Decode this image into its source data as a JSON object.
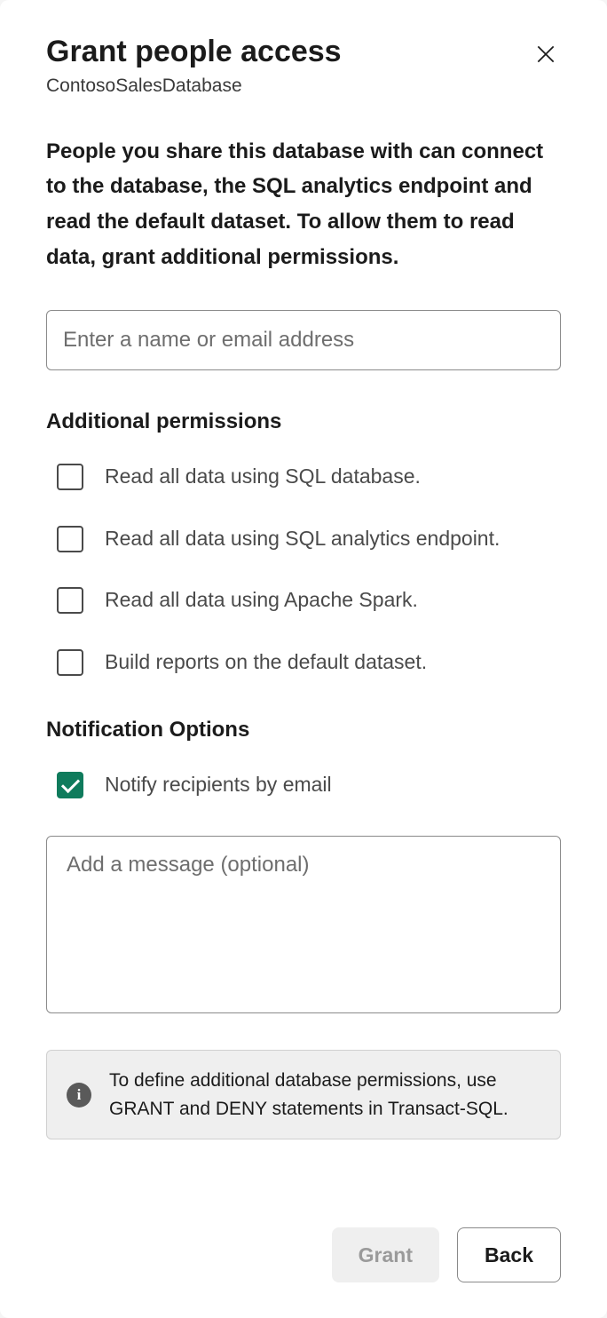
{
  "dialog": {
    "title": "Grant people access",
    "subtitle": "ContosoSalesDatabase",
    "description": "People you share this database with can connect to the database, the SQL analytics endpoint and read the default dataset. To allow them to read data, grant additional permissions."
  },
  "name_input": {
    "placeholder": "Enter a name or email address",
    "value": ""
  },
  "permissions": {
    "heading": "Additional permissions",
    "items": [
      {
        "label": "Read all data using SQL database.",
        "checked": false
      },
      {
        "label": "Read all data using SQL analytics endpoint.",
        "checked": false
      },
      {
        "label": "Read all data using Apache Spark.",
        "checked": false
      },
      {
        "label": "Build reports on the default dataset.",
        "checked": false
      }
    ]
  },
  "notification": {
    "heading": "Notification Options",
    "notify_label": "Notify recipients by email",
    "notify_checked": true,
    "message_placeholder": "Add a message (optional)",
    "message_value": ""
  },
  "info": {
    "icon_text": "i",
    "text": "To define additional database permissions, use GRANT and DENY statements in Transact-SQL."
  },
  "buttons": {
    "grant": "Grant",
    "back": "Back"
  }
}
